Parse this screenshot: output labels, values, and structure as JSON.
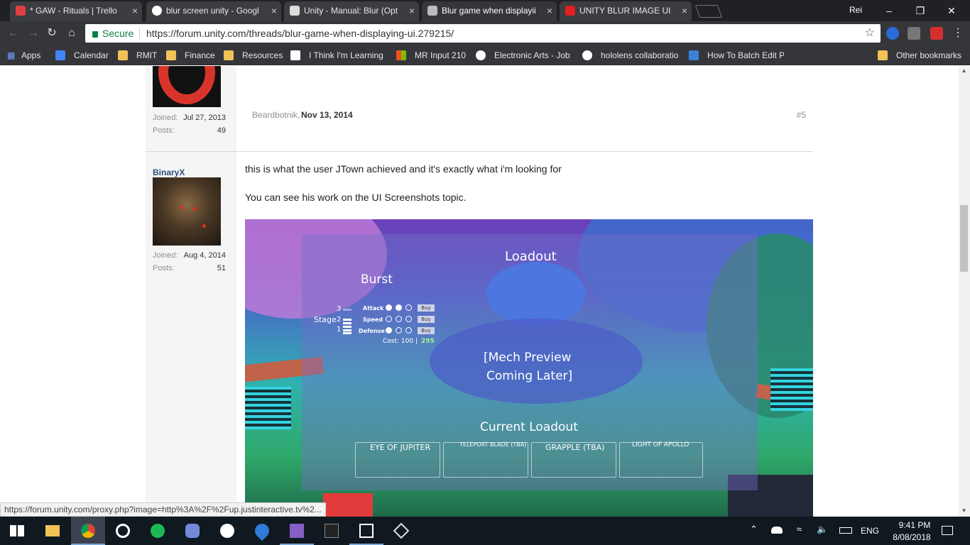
{
  "browser": {
    "tabs": [
      {
        "title": "* GAW - Rituals | Trello",
        "favicon": "trello-icon",
        "color": "#e04040"
      },
      {
        "title": "blur screen unity - Googl",
        "favicon": "google-icon",
        "color": "#ffffff"
      },
      {
        "title": "Unity - Manual: Blur (Opt",
        "favicon": "unity-icon",
        "color": "#dddddd"
      },
      {
        "title": "Blur game when displayii",
        "favicon": "unity-forum-icon",
        "color": "#bbbbbb"
      },
      {
        "title": "UNITY BLUR IMAGE UI",
        "favicon": "youtube-icon",
        "color": "#e02020"
      }
    ],
    "profile": "Rei",
    "secure_label": "Secure",
    "url": "https://forum.unity.com/threads/blur-game-when-displaying-ui.279215/",
    "bookmarks": [
      {
        "label": "Apps",
        "icon": "apps-grid-icon"
      },
      {
        "label": "Calendar",
        "icon": "calendar-icon"
      },
      {
        "label": "RMIT",
        "icon": "folder-icon"
      },
      {
        "label": "Finance",
        "icon": "folder-icon"
      },
      {
        "label": "Resources",
        "icon": "folder-icon"
      },
      {
        "label": "I Think I'm Learning",
        "icon": "bookmark-icon"
      },
      {
        "label": "MR Input 210",
        "icon": "microsoft-icon"
      },
      {
        "label": "Electronic Arts - Job",
        "icon": "ea-icon"
      },
      {
        "label": "hololens collaboratio",
        "icon": "google-icon"
      },
      {
        "label": "How To Batch Edit P",
        "icon": "bookmark-icon"
      }
    ],
    "other_bookmarks": "Other bookmarks"
  },
  "post1": {
    "joined_label": "Joined:",
    "joined": "Jul 27, 2013",
    "posts_label": "Posts:",
    "posts": "49",
    "author": "Beardbotnik,",
    "date": "Nov 13, 2014",
    "number": "#5"
  },
  "post2": {
    "username": "BinaryX",
    "joined_label": "Joined:",
    "joined": "Aug 4, 2014",
    "posts_label": "Posts:",
    "posts": "51",
    "message_1": "this is what the user JTown achieved and it's exactly what i'm looking for",
    "message_2": "You can see his work on the UI Screenshots topic."
  },
  "game": {
    "title": "Loadout",
    "mech_name": "Burst",
    "stage_label": "Stage",
    "stages": [
      "3",
      "2",
      "1"
    ],
    "stats": [
      {
        "label": "Attack",
        "filled": 2
      },
      {
        "label": "Speed",
        "filled": 0
      },
      {
        "label": "Defense",
        "filled": 1
      }
    ],
    "buy_label": "Buy",
    "cost_label": "Cost: 100 |",
    "cost_total": "295",
    "preview_line1": "[Mech Preview",
    "preview_line2": "Coming Later]",
    "current_loadout": "Current Loadout",
    "slots": [
      "EYE OF JUPITER",
      "TELEPORT BLADE (TBA)",
      "GRAPPLE (TBA)",
      "LIGHT OF APOLLO"
    ]
  },
  "status_url": "https://forum.unity.com/proxy.php?image=http%3A%2F%2Fup.justinteractive.tv%2...",
  "taskbar": {
    "apps": [
      "file-explorer-icon",
      "chrome-icon",
      "origin-icon",
      "spotify-icon",
      "discord-icon",
      "slack-icon",
      "maps-icon",
      "visual-studio-icon",
      "epic-games-icon",
      "unity-icon",
      "unity-hub-icon"
    ],
    "language": "ENG",
    "time": "9:41 PM",
    "date": "8/08/2018"
  }
}
